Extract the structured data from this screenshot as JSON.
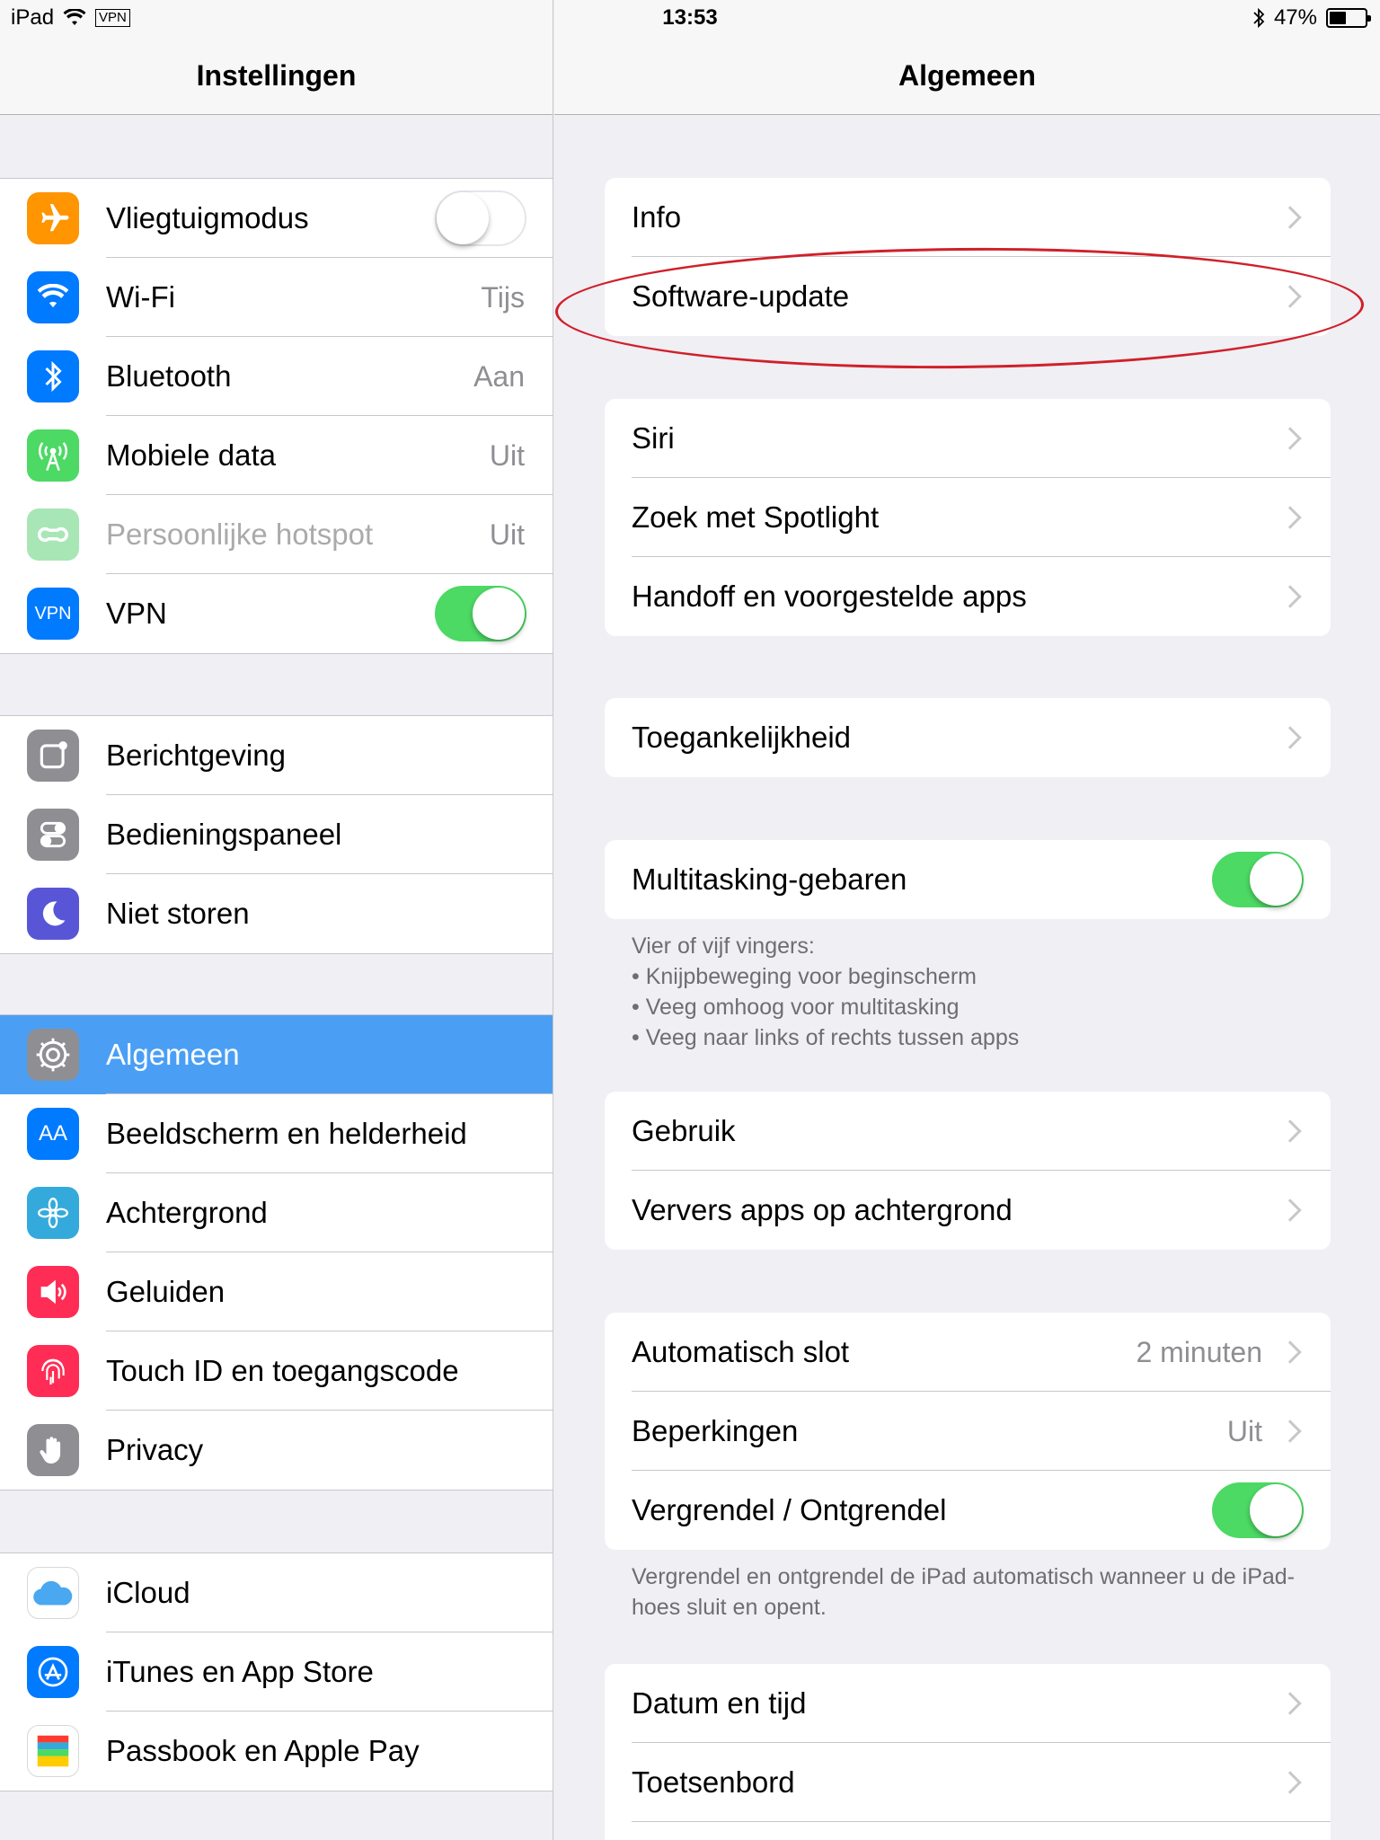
{
  "status_bar": {
    "device": "iPad",
    "vpn": "VPN",
    "time": "13:53",
    "battery": "47%",
    "battery_level": 0.47
  },
  "master": {
    "title": "Instellingen",
    "groups": [
      [
        {
          "label": "Vliegtuigmodus",
          "icon": "airplane-icon",
          "color": "#ff9500",
          "toggle": "off"
        },
        {
          "label": "Wi-Fi",
          "icon": "wifi-icon",
          "color": "#007aff",
          "value": "Tijs"
        },
        {
          "label": "Bluetooth",
          "icon": "bluetooth-icon",
          "color": "#007aff",
          "value": "Aan"
        },
        {
          "label": "Mobiele data",
          "icon": "antenna-icon",
          "color": "#4cd964",
          "value": "Uit"
        },
        {
          "label": "Persoonlijke hotspot",
          "icon": "hotspot-icon",
          "color": "#a8e6b6",
          "value": "Uit"
        },
        {
          "label": "VPN",
          "icon": "vpn-icon",
          "icon_text": "VPN",
          "color": "#007aff",
          "toggle": "on"
        }
      ],
      [
        {
          "label": "Berichtgeving",
          "icon": "notifications-icon",
          "color": "#8e8e93"
        },
        {
          "label": "Bedieningspaneel",
          "icon": "control-center-icon",
          "color": "#8e8e93"
        },
        {
          "label": "Niet storen",
          "icon": "moon-icon",
          "color": "#5856d6"
        }
      ],
      [
        {
          "label": "Algemeen",
          "icon": "gear-icon",
          "color": "#8e8e93",
          "selected": true
        },
        {
          "label": "Beeldscherm en helderheid",
          "icon": "display-icon",
          "icon_text": "AA",
          "color": "#007aff"
        },
        {
          "label": "Achtergrond",
          "icon": "wallpaper-icon",
          "color": "#34aadc"
        },
        {
          "label": "Geluiden",
          "icon": "speaker-icon",
          "color": "#ff2d55"
        },
        {
          "label": "Touch ID en toegangscode",
          "icon": "fingerprint-icon",
          "color": "#ff2d55"
        },
        {
          "label": "Privacy",
          "icon": "hand-icon",
          "color": "#8e8e93"
        }
      ],
      [
        {
          "label": "iCloud",
          "icon": "cloud-icon",
          "color": "#ffffff"
        },
        {
          "label": "iTunes en App Store",
          "icon": "app-store-icon",
          "color": "#007aff"
        },
        {
          "label": "Passbook en Apple Pay",
          "icon": "passbook-icon",
          "color": "#ffffff"
        }
      ]
    ]
  },
  "detail": {
    "title": "Algemeen",
    "cards": [
      [
        {
          "label": "Info"
        },
        {
          "label": "Software-update"
        }
      ],
      [
        {
          "label": "Siri"
        },
        {
          "label": "Zoek met Spotlight"
        },
        {
          "label": "Handoff en voorgestelde apps"
        }
      ],
      [
        {
          "label": "Toegankelijkheid"
        }
      ],
      [
        {
          "label": "Multitasking-gebaren",
          "toggle": "on"
        }
      ],
      [
        {
          "label": "Gebruik"
        },
        {
          "label": "Ververs apps op achtergrond"
        }
      ],
      [
        {
          "label": "Automatisch slot",
          "value": "2 minuten"
        },
        {
          "label": "Beperkingen",
          "value": "Uit"
        },
        {
          "label": "Vergrendel / Ontgrendel",
          "toggle": "on"
        }
      ],
      [
        {
          "label": "Datum en tijd"
        },
        {
          "label": "Toetsenbord"
        },
        {
          "label": ""
        }
      ]
    ],
    "multitasking_note": [
      "Vier of vijf vingers:",
      "• Knijpbeweging voor beginscherm",
      "• Veeg omhoog voor multitasking",
      "• Veeg naar links of rechts tussen apps"
    ],
    "lock_note": "Vergrendel en ontgrendel de iPad automatisch wanneer u de iPad-hoes sluit en opent."
  }
}
